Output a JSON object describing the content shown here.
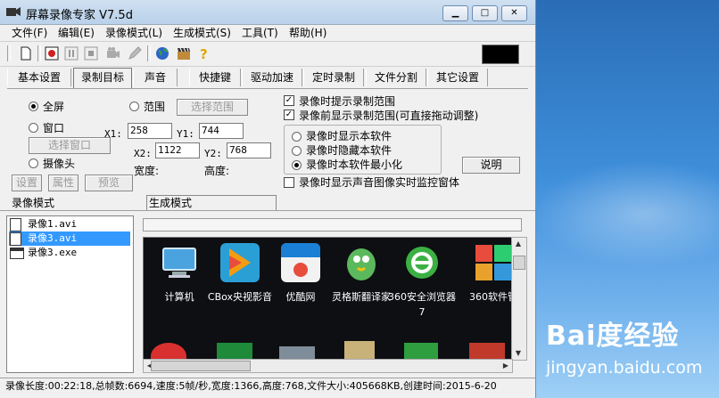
{
  "window": {
    "title": "屏幕录像专家 V7.5d",
    "controls": {
      "minimize": "▁",
      "maximize": "□",
      "close": "✕"
    }
  },
  "menu": [
    "文件(F)",
    "编辑(E)",
    "录像模式(L)",
    "生成模式(S)",
    "工具(T)",
    "帮助(H)"
  ],
  "toolbar_icons": [
    "new-file-icon",
    "record-icon",
    "pause-icon",
    "stop-icon",
    "camera-icon",
    "pen-icon",
    "globe-icon",
    "movie-clapper-icon",
    "help-icon"
  ],
  "tabs": [
    "基本设置",
    "录制目标",
    "声音",
    "快捷键",
    "驱动加速",
    "定时录制",
    "文件分割",
    "其它设置"
  ],
  "active_tab": "录制目标",
  "target": {
    "fullscreen": "全屏",
    "region": "范围",
    "select_region_button": "选择范围",
    "window": "窗口",
    "select_window_button": "选择窗口",
    "camera": "摄像头",
    "settings_button": "设置",
    "properties_button": "属性",
    "preview_button": "预览",
    "x1_label": "X1:",
    "x1_value": "258",
    "y1_label": "Y1:",
    "y1_value": "744",
    "x2_label": "X2:",
    "x2_value": "1122",
    "y2_label": "Y2:",
    "y2_value": "768",
    "width_label": "宽度:",
    "height_label": "高度:"
  },
  "options": {
    "prompt_range": "录像时提示录制范围",
    "show_range": "录像前显示录制范围(可直接拖动调整)",
    "show_software": "录像时显示本软件",
    "hide_software": "录像时隐藏本软件",
    "minimize_software": "录像时本软件最小化",
    "explain_button": "说明",
    "monitor_window": "录像时显示声音图像实时监控窗体"
  },
  "sections": {
    "record_mode": "录像模式",
    "generate_mode": "生成模式"
  },
  "files": [
    {
      "name": "录像1.avi",
      "icon": "document-icon",
      "selected": false
    },
    {
      "name": "录像3.avi",
      "icon": "document-icon",
      "selected": true
    },
    {
      "name": "录像3.exe",
      "icon": "exe-icon",
      "selected": false
    }
  ],
  "preview_icons": [
    {
      "label": "计算机",
      "icon": "computer-icon",
      "color": "#4aa3df"
    },
    {
      "label": "CBox央视影音",
      "icon": "cbox-icon",
      "color": "#2a9fd6"
    },
    {
      "label": "优酷网",
      "icon": "youku-icon",
      "color": "#f2f2f2"
    },
    {
      "label": "灵格斯翻译家",
      "icon": "lingoes-icon",
      "color": "#5cb85c"
    },
    {
      "label": "360安全浏览器7",
      "icon": "360-browser-icon",
      "color": "#3cb043"
    },
    {
      "label": "360软件管",
      "icon": "360-software-icon",
      "color": "#e8a22b"
    }
  ],
  "status": "录像长度:00:22:18,总帧数:6694,速度:5帧/秒,宽度:1366,高度:768,文件大小:405668KB,创建时间:2015-6-20",
  "watermark": {
    "logo": "Bai度经验",
    "url": "jingyan.baidu.com"
  },
  "colors": {
    "selection": "#3399ff",
    "desktop": "#3a7dc4"
  }
}
